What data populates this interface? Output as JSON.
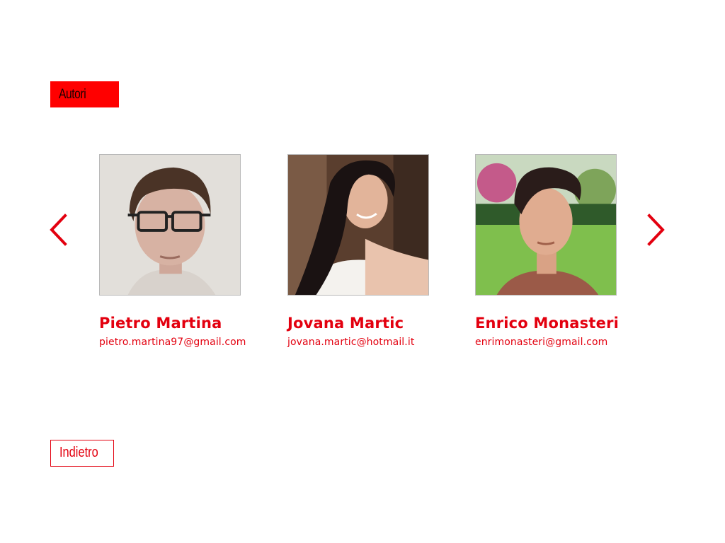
{
  "section": {
    "title": "Autori"
  },
  "carousel": {
    "prev_icon": "chevron-left-icon",
    "next_icon": "chevron-right-icon",
    "accent_color": "#e3000f",
    "authors": [
      {
        "name": "Pietro Martina",
        "email": "pietro.martina97@gmail.com"
      },
      {
        "name": "Jovana Martic",
        "email": "jovana.martic@hotmail.it"
      },
      {
        "name": "Enrico Monasteri",
        "email": "enrimonasteri@gmail.com"
      }
    ]
  },
  "footer": {
    "back_label": "Indietro"
  }
}
